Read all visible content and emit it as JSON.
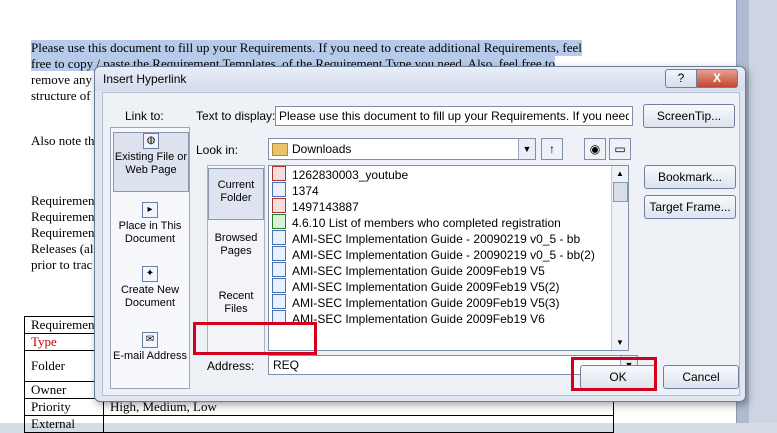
{
  "document": {
    "para1": [
      "Please use this document to fill up your Requirements. If you need to create additional Requirements, feel",
      "free to copy / paste the Requirement Templates, of the Requirement Type you need. Also, feel free to",
      "remove any",
      "structure of"
    ],
    "para2": "Also note th",
    "para3": [
      "Requiremen",
      "Requiremen",
      "Requiremen",
      "Releases (al",
      "prior to trac"
    ],
    "table": [
      {
        "label": "Requiremen",
        "value": "",
        "red": false
      },
      {
        "label": "Type",
        "value": "",
        "red": true
      },
      {
        "label": "Folder",
        "value": "",
        "red": false
      },
      {
        "label": "Owner",
        "value": "",
        "red": false
      },
      {
        "label": "Priority",
        "value": "High, Medium, Low",
        "red": false
      },
      {
        "label": "External",
        "value": "",
        "red": false
      }
    ]
  },
  "dialog": {
    "title": "Insert Hyperlink",
    "help_label": "?",
    "close_label": "X",
    "link_to_label": "Link to:",
    "link_to": {
      "existing": "Existing File or Web Page",
      "place": "Place in This Document",
      "new_doc": "Create New Document",
      "email": "E-mail Address"
    },
    "text_to_display_label": "Text to display:",
    "text_to_display_value": "Please use this document to fill up your Requirements. If you need to crea",
    "screentip_label": "ScreenTip...",
    "look_in_label": "Look in:",
    "look_in_value": "Downloads",
    "nav": {
      "current": "Current Folder",
      "browsed": "Browsed Pages",
      "recent": "Recent Files"
    },
    "files": [
      {
        "name": "1262830003_youtube",
        "icon": "red"
      },
      {
        "name": "1374",
        "icon": "word"
      },
      {
        "name": "1497143887",
        "icon": "red"
      },
      {
        "name": "4.6.10 List of members who completed registration",
        "icon": "green"
      },
      {
        "name": "AMI-SEC Implementation Guide - 20090219 v0_5 - bb",
        "icon": "word"
      },
      {
        "name": "AMI-SEC Implementation Guide - 20090219 v0_5 - bb(2)",
        "icon": "word"
      },
      {
        "name": "AMI-SEC Implementation Guide 2009Feb19 V5",
        "icon": "word"
      },
      {
        "name": "AMI-SEC Implementation Guide 2009Feb19 V5(2)",
        "icon": "word"
      },
      {
        "name": "AMI-SEC Implementation Guide 2009Feb19 V5(3)",
        "icon": "word"
      },
      {
        "name": "AMI-SEC Implementation Guide 2009Feb19 V6",
        "icon": "word"
      }
    ],
    "bookmark_label": "Bookmark...",
    "target_frame_label": "Target Frame...",
    "address_label": "Address:",
    "address_value": "REQ",
    "ok_label": "OK",
    "cancel_label": "Cancel"
  }
}
